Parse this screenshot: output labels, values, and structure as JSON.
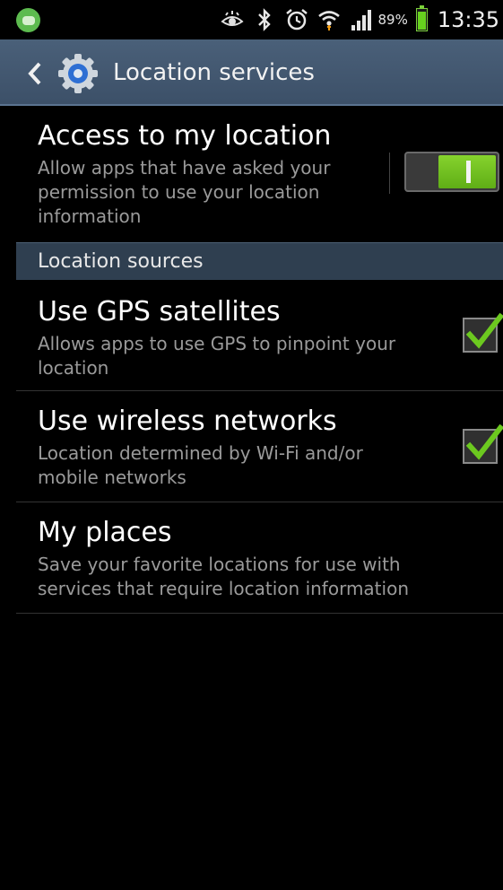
{
  "status_bar": {
    "battery_percent": "89%",
    "battery_level": 0.89,
    "time": "13:35",
    "icons": [
      "app-notification-icon",
      "eye-icon",
      "bluetooth-icon",
      "alarm-icon",
      "wifi-icon",
      "signal-icon",
      "battery-icon"
    ]
  },
  "action_bar": {
    "title": "Location services",
    "icons": [
      "back-icon",
      "gear-icon"
    ]
  },
  "access": {
    "title": "Access to my location",
    "summary_line1": "Allow apps that have asked your",
    "summary_line2": "permission to use your location",
    "summary_line3": "information",
    "toggle_on": true
  },
  "section": {
    "label": "Location sources"
  },
  "gps": {
    "title": "Use GPS satellites",
    "summary_line1": "Allows apps to use GPS to pinpoint your",
    "summary_line2": "location",
    "checked": true
  },
  "wireless": {
    "title": "Use wireless networks",
    "summary_line1": "Location determined by Wi-Fi and/or",
    "summary_line2": "mobile networks",
    "checked": true
  },
  "places": {
    "title": "My places",
    "summary_line1": "Save your favorite locations for use with",
    "summary_line2": "services that require location information"
  },
  "colors": {
    "accent_green": "#6cc91f",
    "action_bar": "#4a6079",
    "section_header": "#2f3f50"
  }
}
